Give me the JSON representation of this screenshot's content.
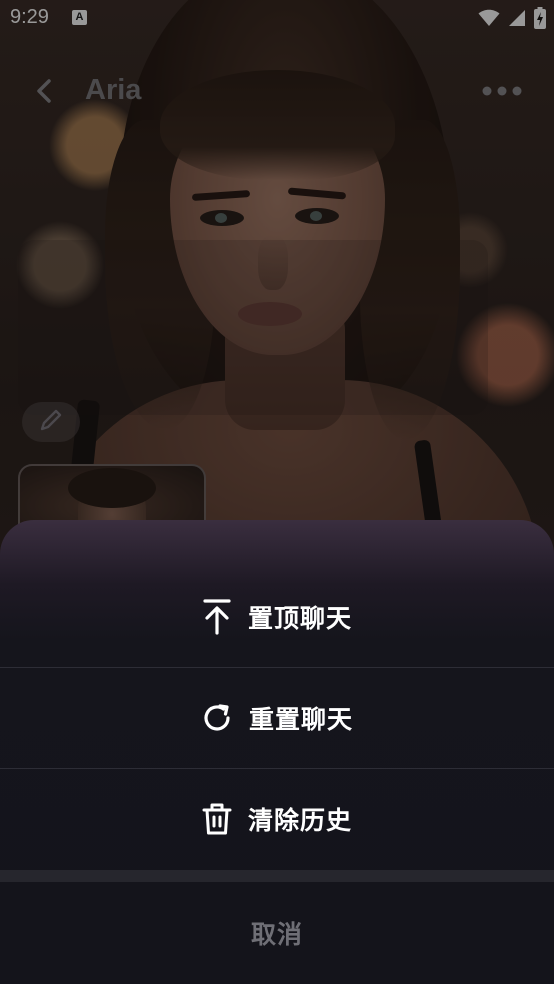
{
  "status_bar": {
    "time": "9:29",
    "notification_badge": "A"
  },
  "header": {
    "title": "Aria"
  },
  "action_sheet": {
    "actions": [
      {
        "label": "置顶聊天",
        "icon": "pin-to-top-icon"
      },
      {
        "label": "重置聊天",
        "icon": "refresh-icon"
      },
      {
        "label": "清除历史",
        "icon": "trash-icon"
      }
    ],
    "cancel_label": "取消"
  },
  "colors": {
    "sheet_background": "#14141b",
    "sheet_top_tint": "#3a2e3f",
    "action_text": "#ffffff",
    "cancel_text": "#6f6f76",
    "title_text": "#7e7c7f"
  }
}
